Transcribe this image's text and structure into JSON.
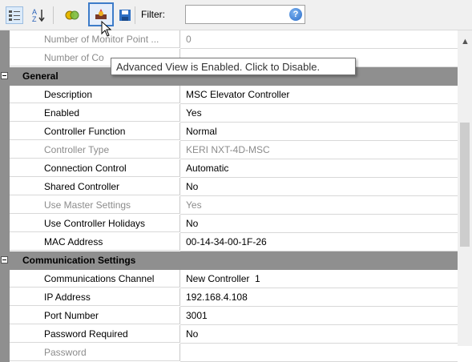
{
  "toolbar": {
    "filter_label": "Filter:",
    "filter_value": "",
    "help_glyph": "?",
    "icons": [
      "categorized-icon",
      "alphabetical-icon",
      "events-icon",
      "advanced-view-icon",
      "save-icon",
      "help-icon"
    ]
  },
  "tooltip": "Advanced View is Enabled. Click to Disable.",
  "partial_rows": [
    {
      "name": "Number of Monitor Point ...",
      "value": "0"
    },
    {
      "name": "Number of Co",
      "value": ""
    }
  ],
  "categories": [
    {
      "label": "General",
      "rows": [
        {
          "name": "Description",
          "value": "MSC Elevator Controller",
          "disabled": false
        },
        {
          "name": "Enabled",
          "value": "Yes",
          "disabled": false
        },
        {
          "name": "Controller Function",
          "value": "Normal",
          "disabled": false
        },
        {
          "name": "Controller Type",
          "value": "KERI NXT-4D-MSC",
          "disabled": true
        },
        {
          "name": "Connection Control",
          "value": "Automatic",
          "disabled": false
        },
        {
          "name": "Shared Controller",
          "value": "No",
          "disabled": false
        },
        {
          "name": "Use Master Settings",
          "value": "Yes",
          "disabled": true
        },
        {
          "name": "Use Controller Holidays",
          "value": "No",
          "disabled": false
        },
        {
          "name": "MAC Address",
          "value": "00-14-34-00-1F-26",
          "disabled": false
        }
      ]
    },
    {
      "label": "Communication Settings",
      "rows": [
        {
          "name": "Communications Channel",
          "value": "New Controller  1",
          "disabled": false
        },
        {
          "name": "IP Address",
          "value": "192.168.4.108",
          "disabled": false
        },
        {
          "name": "Port Number",
          "value": "3001",
          "disabled": false
        },
        {
          "name": "Password Required",
          "value": "No",
          "disabled": false
        },
        {
          "name": "Password",
          "value": "",
          "disabled": true
        }
      ]
    }
  ],
  "colors": {
    "category_bg": "#8f8f8f",
    "disabled_text": "#8c8c8c",
    "highlight_border": "#3d7cc9"
  }
}
